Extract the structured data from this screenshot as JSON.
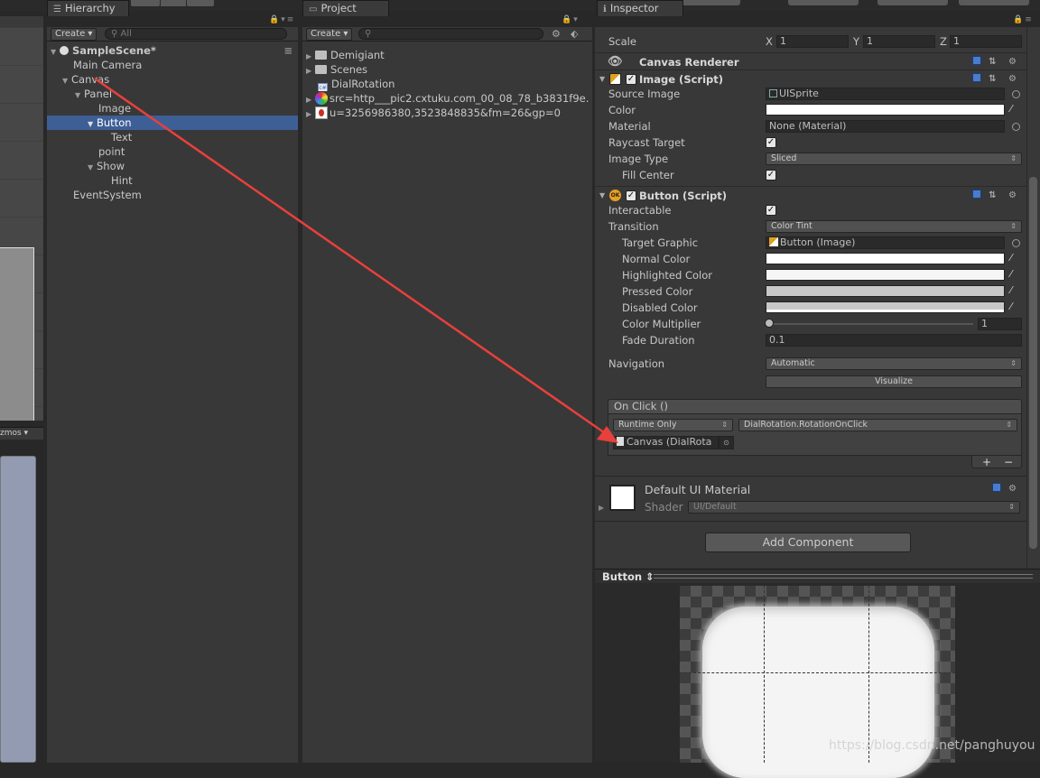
{
  "hierarchy": {
    "tab_label": "Hierarchy",
    "create_label": "Create",
    "search_placeholder": "All",
    "scene_name": "SampleScene*",
    "rows": [
      "Main Camera",
      "Canvas",
      "Panel",
      "Image",
      "Button",
      "Text",
      "point",
      "Show",
      "Hint",
      "EventSystem"
    ]
  },
  "project": {
    "tab_label": "Project",
    "create_label": "Create",
    "items": [
      "Demigiant",
      "Scenes",
      "DialRotation",
      "src=http___pic2.cxtuku.com_00_08_78_b3831f9e.",
      "u=3256986380,3523848835&fm=26&gp=0"
    ]
  },
  "scene_view": {
    "gizmos_label": "zmos"
  },
  "inspector": {
    "tab_label": "Inspector",
    "scale_label": "Scale",
    "scale": {
      "x_label": "X",
      "x": "1",
      "y_label": "Y",
      "y": "1",
      "z_label": "Z",
      "z": "1"
    },
    "canvas_renderer": "Canvas Renderer",
    "image_script": {
      "title": "Image (Script)",
      "source_image_label": "Source Image",
      "source_image_value": "UISprite",
      "color_label": "Color",
      "material_label": "Material",
      "material_value": "None (Material)",
      "raycast_label": "Raycast Target",
      "image_type_label": "Image Type",
      "image_type_value": "Sliced",
      "fill_center_label": "Fill Center"
    },
    "button_script": {
      "title": "Button (Script)",
      "interactable_label": "Interactable",
      "transition_label": "Transition",
      "transition_value": "Color Tint",
      "target_graphic_label": "Target Graphic",
      "target_graphic_value": "Button (Image)",
      "normal_color_label": "Normal Color",
      "highlighted_color_label": "Highlighted Color",
      "pressed_color_label": "Pressed Color",
      "disabled_color_label": "Disabled Color",
      "color_multiplier_label": "Color Multiplier",
      "color_multiplier_value": "1",
      "fade_duration_label": "Fade Duration",
      "fade_duration_value": "0.1",
      "navigation_label": "Navigation",
      "navigation_value": "Automatic",
      "visualize_label": "Visualize",
      "onclick_header": "On Click ()",
      "runtime_value": "Runtime Only",
      "function_value": "DialRotation.RotationOnClick",
      "object_value": "Canvas (DialRota",
      "plus": "+",
      "minus": "−"
    },
    "material": {
      "name": "Default UI Material",
      "shader_label": "Shader",
      "shader_value": "UI/Default"
    },
    "add_component_label": "Add Component"
  },
  "preview": {
    "title": "Button",
    "watermark": "https://blog.csdn.net/panghuyou"
  },
  "colors": {
    "panel": "#383838",
    "selection": "#3e5f96",
    "arrow": "#e8403c"
  }
}
